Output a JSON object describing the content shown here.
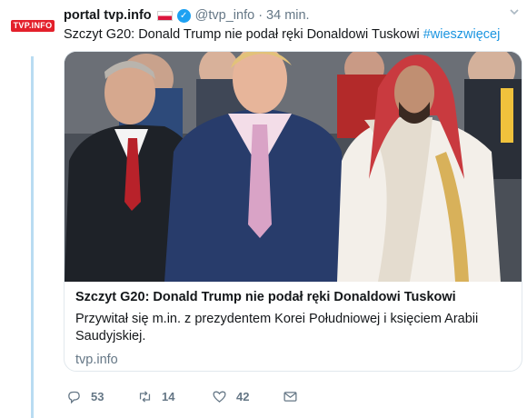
{
  "tweet": {
    "avatar_label": "TVP.INFO",
    "display_name": "portal tvp.info",
    "handle": "@tvp_info",
    "separator": "·",
    "time": "34 min.",
    "text": "Szczyt G20: Donald Trump nie podał ręki Donaldowi Tuskowi",
    "hashtag": "#wieszwięcej"
  },
  "card": {
    "title": "Szczyt G20: Donald Trump nie podał ręki Donaldowi Tuskowi",
    "description": "Przywitał się m.in. z prezydentem Korei Południowej i księciem Arabii Saudyjskiej.",
    "domain": "tvp.info"
  },
  "actions": {
    "replies": "53",
    "retweets": "14",
    "likes": "42"
  },
  "colors": {
    "brand": "#e3202b",
    "link": "#1b95e0",
    "muted": "#657786",
    "thread": "#b9dcf2"
  },
  "icons": [
    "caret-down-icon",
    "verified-badge-icon",
    "poland-flag-icon",
    "reply-icon",
    "retweet-icon",
    "like-icon",
    "dm-icon"
  ]
}
